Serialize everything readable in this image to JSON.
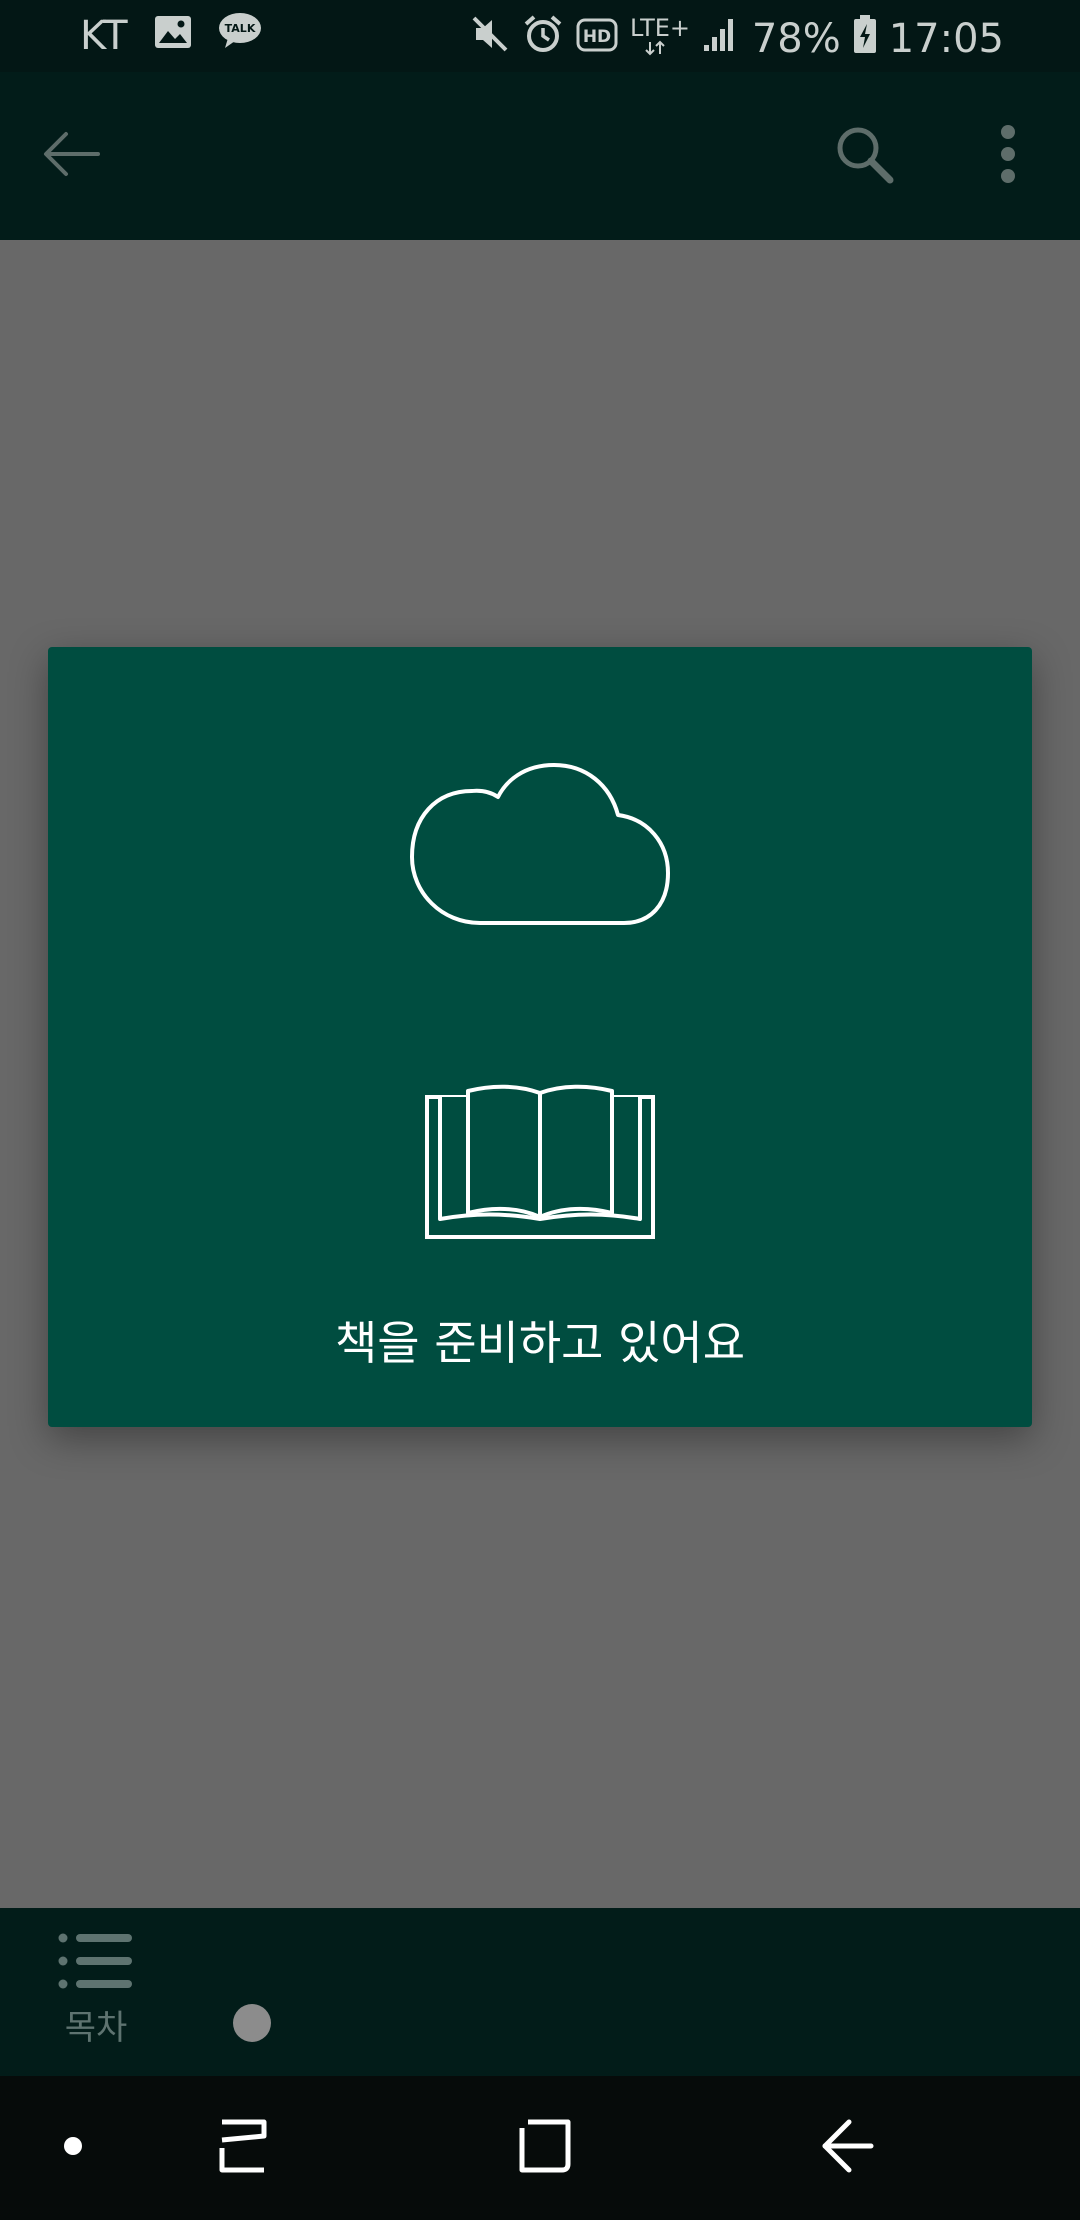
{
  "status_bar": {
    "carrier": "KT",
    "network": "LTE+",
    "battery": "78%",
    "time": "17:05",
    "icons": [
      "gallery-icon",
      "kakaotalk-icon",
      "mute-icon",
      "alarm-icon",
      "hd-icon",
      "signal-icon",
      "battery-charging-icon"
    ],
    "talk_badge": "TALK",
    "hd_badge": "HD"
  },
  "app_bar": {
    "icons": [
      "back-arrow-icon",
      "search-icon",
      "more-vert-icon"
    ]
  },
  "dialog": {
    "icons": [
      "cloud-icon",
      "open-book-icon"
    ],
    "message": "책을 준비하고 있어요"
  },
  "bottom_bar": {
    "toc_label": "목차",
    "icons": [
      "list-icon"
    ],
    "progress": 0
  },
  "nav_bar": {
    "icons": [
      "dot-icon",
      "recents-icon",
      "home-icon",
      "back-icon"
    ]
  },
  "colors": {
    "dialog_bg": "#004d40",
    "bar_bg": "#021c19",
    "overlay": "#686868"
  }
}
